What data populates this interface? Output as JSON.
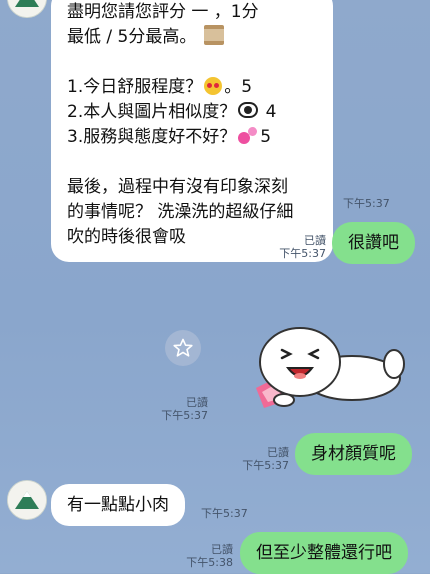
{
  "chat": {
    "messages": [
      {
        "id": "m1",
        "direction": "incoming",
        "lines": [
          "盡明您請您評分 一 ，1分",
          "最低 / 5分最高。",
          "",
          "1.今日舒服程度？",
          "2.本人與圖片相似度？",
          "3.服務與態度好不好？",
          "",
          "最後，過程中有沒有印象深刻",
          "的事情呢？ 洗澡洗的超級仔細",
          "吹的時後很會吸"
        ],
        "ratings": [
          "。5",
          "4",
          "5"
        ],
        "time": "下午5:37"
      },
      {
        "id": "m2",
        "direction": "outgoing",
        "text": "很讚吧",
        "read": "已讀",
        "time": "下午5:37"
      },
      {
        "id": "m3",
        "direction": "outgoing",
        "type": "sticker",
        "read": "已讀",
        "time": "下午5:37"
      },
      {
        "id": "m4",
        "direction": "outgoing",
        "text": "身材顏質呢",
        "read": "已讀",
        "time": "下午5:37"
      },
      {
        "id": "m5",
        "direction": "incoming",
        "text": "有一點點小肉",
        "time": "下午5:37"
      },
      {
        "id": "m6",
        "direction": "outgoing",
        "text": "但至少整體還行吧",
        "read": "已讀",
        "time": "下午5:38"
      }
    ]
  },
  "colors": {
    "background": "#8fa9cc",
    "incoming_bubble": "#ffffff",
    "outgoing_bubble": "#84e08d",
    "meta_text": "#44546a"
  },
  "icons": {
    "avatar": "mountain-avatar-icon",
    "sticker_action": "star-icon",
    "rating_1": "heart-eyes-emoji-icon",
    "rating_2": "eye-emoji-icon",
    "rating_3": "two-hearts-emoji-icon"
  }
}
